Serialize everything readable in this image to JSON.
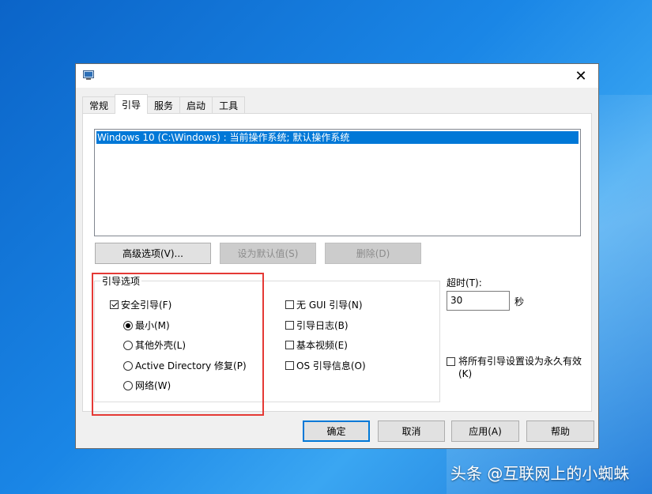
{
  "dialog": {
    "close_icon": "close-icon",
    "tabs": [
      {
        "label": "常规",
        "active": false
      },
      {
        "label": "引导",
        "active": true
      },
      {
        "label": "服务",
        "active": false
      },
      {
        "label": "启动",
        "active": false
      },
      {
        "label": "工具",
        "active": false
      }
    ],
    "os_list": {
      "selected_entry": "Windows 10 (C:\\Windows) : 当前操作系统; 默认操作系统"
    },
    "buttons": {
      "advanced": "高级选项(V)...",
      "set_default": "设为默认值(S)",
      "delete": "删除(D)"
    },
    "boot_options": {
      "title": "引导选项",
      "safe_boot": {
        "label": "安全引导(F)",
        "checked": true
      },
      "radios": [
        {
          "label": "最小(M)",
          "checked": true
        },
        {
          "label": "其他外壳(L)",
          "checked": false
        },
        {
          "label": "Active Directory 修复(P)",
          "checked": false
        },
        {
          "label": "网络(W)",
          "checked": false
        }
      ],
      "checks": [
        {
          "label": "无 GUI 引导(N)",
          "checked": false
        },
        {
          "label": "引导日志(B)",
          "checked": false
        },
        {
          "label": "基本视频(E)",
          "checked": false
        },
        {
          "label": "OS 引导信息(O)",
          "checked": false
        }
      ]
    },
    "timeout": {
      "label": "超时(T):",
      "value": "30",
      "unit": "秒"
    },
    "permanent": {
      "label": "将所有引导设置设为永久有效(K)",
      "checked": false
    },
    "footer": {
      "ok": "确定",
      "cancel": "取消",
      "apply": "应用(A)",
      "help": "帮助"
    }
  },
  "watermark": "头条 @互联网上的小蜘蛛",
  "colors": {
    "selection": "#0078d7",
    "highlight_box": "#e53935"
  }
}
